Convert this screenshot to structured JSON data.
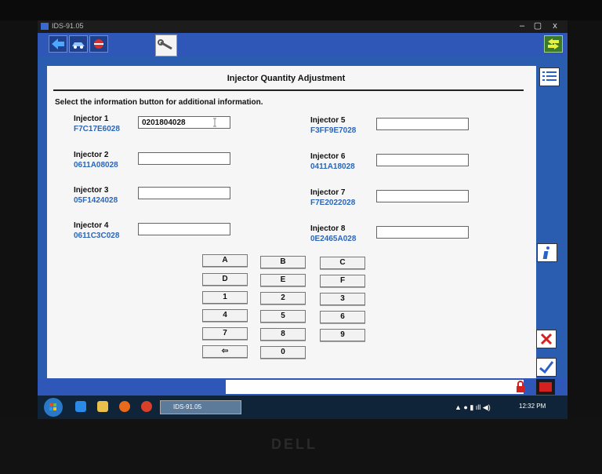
{
  "window": {
    "title": "IDS-91.05",
    "minimize": "–",
    "maximize": "▢",
    "close": "x"
  },
  "toolbar": {
    "icons": [
      "back-arrow-icon",
      "vehicle-icon",
      "tools-icon",
      "wrench-icon",
      "swap-icon"
    ]
  },
  "page": {
    "title": "Injector Quantity Adjustment",
    "instruction": "Select the information button for additional information."
  },
  "injectors": [
    {
      "label": "Injector 1",
      "code": "F7C17E6028",
      "value": "0201804028"
    },
    {
      "label": "Injector 2",
      "code": "0611A08028",
      "value": ""
    },
    {
      "label": "Injector 3",
      "code": "05F1424028",
      "value": ""
    },
    {
      "label": "Injector 4",
      "code": "0611C3C028",
      "value": ""
    },
    {
      "label": "Injector 5",
      "code": "F3FF9E7028",
      "value": ""
    },
    {
      "label": "Injector 6",
      "code": "0411A18028",
      "value": ""
    },
    {
      "label": "Injector 7",
      "code": "F7E2022028",
      "value": ""
    },
    {
      "label": "Injector 8",
      "code": "0E2465A028",
      "value": ""
    }
  ],
  "keypad": {
    "keys": [
      "A",
      "B",
      "C",
      "D",
      "E",
      "F",
      "1",
      "2",
      "3",
      "4",
      "5",
      "6",
      "7",
      "8",
      "9",
      "⇦",
      "0"
    ]
  },
  "sidebar": {
    "icons": [
      "list-icon",
      "info-icon",
      "cancel-icon",
      "confirm-icon"
    ]
  },
  "taskbar": {
    "app_label": "IDS-91.05",
    "time": "12:32 PM"
  },
  "bezel": {
    "brand": "DELL"
  },
  "colors": {
    "accent": "#2f57b8",
    "code_text": "#2b66b8",
    "cancel": "#d42020",
    "confirm": "#2a62c8"
  }
}
